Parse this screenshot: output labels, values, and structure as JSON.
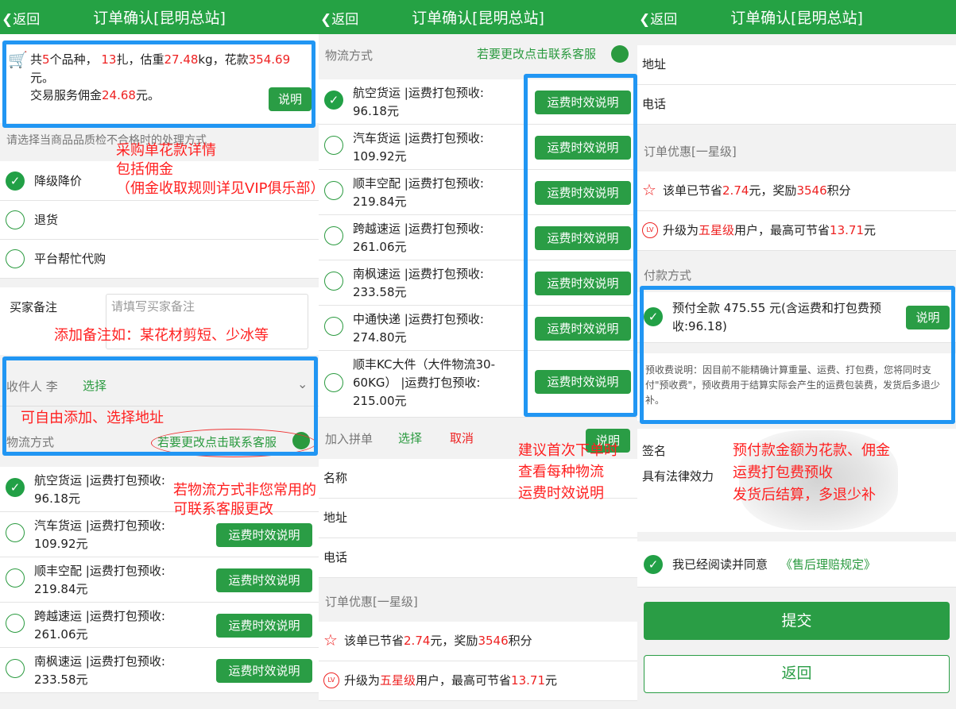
{
  "header": {
    "back": "返回",
    "title": "订单确认[昆明总站]"
  },
  "summary": {
    "l1a": "共",
    "kinds": "5",
    "l1b": "个品种，",
    "bundles": "13",
    "l1c": "扎，估重",
    "weight": "27.48",
    "l1d": "kg，花款",
    "amount": "354.69",
    "l1e": "元。",
    "l2a": "交易服务佣金",
    "commission": "24.68",
    "l2b": "元。",
    "explain": "说明"
  },
  "quality": {
    "label": "请选择当商品品质检不合格时的处理方式",
    "options": [
      "降级降价",
      "退货",
      "平台帮忙代购"
    ]
  },
  "remark": {
    "label": "买家备注",
    "placeholder": "请填写买家备注"
  },
  "receiver": {
    "label": "收件人 李",
    "select": "选择"
  },
  "logistics": {
    "label": "物流方式",
    "contact": "若要更改点击联系客服",
    "btn": "运费时效说明",
    "items": [
      {
        "name": "航空货运 |运费打包预收:",
        "price": "96.18元"
      },
      {
        "name": "汽车货运 |运费打包预收:",
        "price": "109.92元"
      },
      {
        "name": "顺丰空配 |运费打包预收:",
        "price": "219.84元"
      },
      {
        "name": "跨越速运 |运费打包预收:",
        "price": "261.06元"
      },
      {
        "name": "南枫速运 |运费打包预收:",
        "price": "233.58元"
      },
      {
        "name": "中通快递 |运费打包预收:",
        "price": "274.80元"
      },
      {
        "name": "顺丰KC大件（大件物流30-60KG） |运费打包预收:",
        "price": "215.00元"
      }
    ]
  },
  "group": {
    "label": "加入拼单",
    "select": "选择",
    "cancel": "取消",
    "explain": "说明"
  },
  "fields": {
    "name": "名称",
    "address": "地址",
    "phone": "电话"
  },
  "discount": {
    "title": "订单优惠[一星级]",
    "saveA": "该单已节省",
    "save": "2.74",
    "saveB": "元，奖励",
    "points": "3546",
    "saveC": "积分",
    "upA": "升级为",
    "level": "五星级",
    "upB": "用户，最高可节省",
    "upMax": "13.71",
    "upC": "元"
  },
  "payment": {
    "title": "付款方式",
    "text": "预付全款 475.55 元(含运费和打包费预收:96.18)",
    "explain": "说明",
    "note": "预收费说明：因目前不能精确计算重量、运费、打包费，您将同时支付\"预收费\"，预收费用于结算实际会产生的运费包装费，发货后多退少补。"
  },
  "sign": {
    "label": "签名",
    "legal": "具有法律效力"
  },
  "agree": {
    "text": "我已经阅读并同意",
    "link": "《售后理赔规定》"
  },
  "actions": {
    "submit": "提交",
    "back": "返回"
  },
  "annotations": {
    "a1": "采购单花款详情\n包括佣金\n（佣金收取规则详见VIP俱乐部）",
    "a2": "添加备注如：某花材剪短、少冰等",
    "a3": "可自由添加、选择地址",
    "a4": "若物流方式非您常用的\n可联系客服更改",
    "a5": "建议首次下单时\n查看每种物流\n运费时效说明",
    "a6": "预付款金额为花款、佣金\n运费打包费预收\n发货后结算，多退少补"
  },
  "colors": {
    "green": "#25a244",
    "red": "#e22",
    "blue": "#2196f3"
  }
}
